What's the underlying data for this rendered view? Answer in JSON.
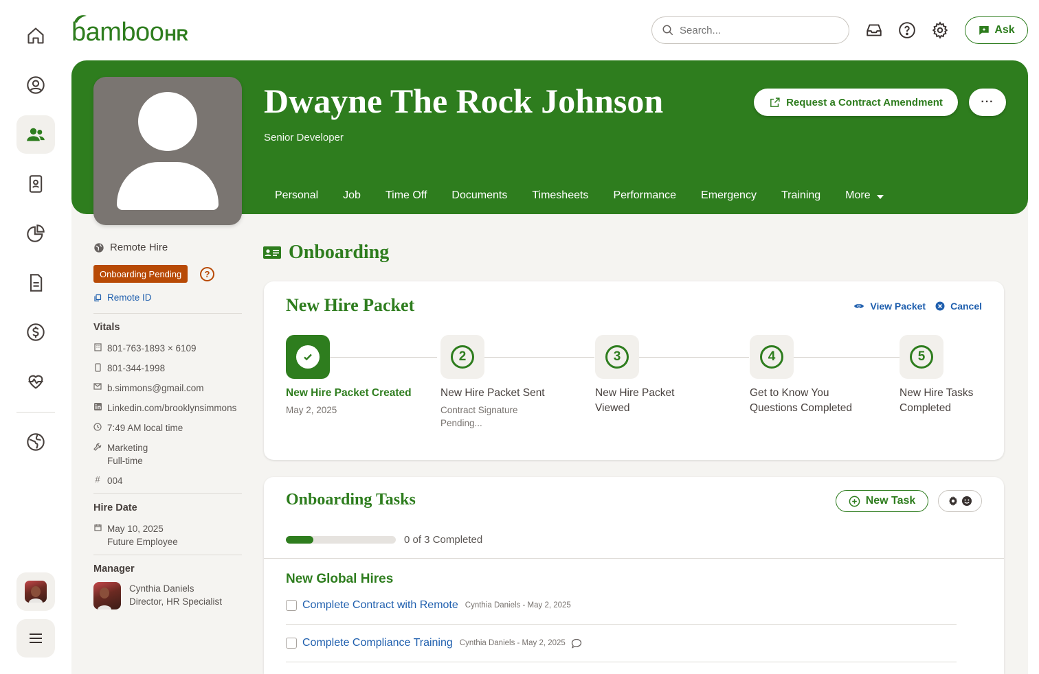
{
  "app": {
    "logo_word": "bamboo",
    "logo_suffix": "HR"
  },
  "search": {
    "placeholder": "Search..."
  },
  "topbar": {
    "ask_label": "Ask",
    "icons": [
      "inbox-icon",
      "help-icon",
      "settings-icon"
    ]
  },
  "rail": {
    "items": [
      "home-icon",
      "user-circle-icon",
      "people-icon",
      "badge-icon",
      "pie-chart-icon",
      "document-icon",
      "dollar-icon",
      "heart-pulse-icon",
      "globe-icon"
    ],
    "active": "people-icon"
  },
  "employee": {
    "name": "Dwayne The Rock Johnson",
    "title": "Senior Developer",
    "amend_label": "Request a Contract Amendment",
    "more_label": "···"
  },
  "tabs": [
    "Personal",
    "Job",
    "Time Off",
    "Documents",
    "Timesheets",
    "Performance",
    "Emergency",
    "Training",
    "More"
  ],
  "side": {
    "remote_hire": "Remote Hire",
    "badge": "Onboarding Pending",
    "remote_id": "Remote ID",
    "vitals_heading": "Vitals",
    "work_phone": "801-763-1893 × 6109",
    "mobile_phone": "801-344-1998",
    "email": "b.simmons@gmail.com",
    "linkedin": "Linkedin.com/brooklynsimmons",
    "local_time": "7:49 AM local time",
    "department": "Marketing",
    "employment_type": "Full-time",
    "employee_number": "004",
    "hire_heading": "Hire Date",
    "hire_date": "May 10, 2025",
    "hire_status": "Future Employee",
    "manager_heading": "Manager",
    "manager_name": "Cynthia Daniels",
    "manager_title": "Director, HR Specialist"
  },
  "onboarding": {
    "title": "Onboarding",
    "packet": {
      "title": "New Hire Packet",
      "view_label": "View Packet",
      "cancel_label": "Cancel",
      "steps": [
        {
          "label": "New Hire Packet Created",
          "sub": "May 2, 2025",
          "done": true
        },
        {
          "label": "New Hire Packet Sent",
          "sub": "Contract Signature Pending...",
          "number": "2"
        },
        {
          "label": "New Hire Packet Viewed",
          "sub": "",
          "number": "3"
        },
        {
          "label": "Get to Know You Questions Completed",
          "sub": "",
          "number": "4"
        },
        {
          "label": "New Hire Tasks Completed",
          "sub": "",
          "number": "5"
        }
      ]
    },
    "tasks": {
      "title": "Onboarding Tasks",
      "new_task_label": "New Task",
      "progress": 0.25,
      "progress_text": "0 of 3 Completed",
      "group_title": "New Global Hires",
      "items": [
        {
          "name": "Complete Contract with Remote",
          "meta": "Cynthia Daniels - May 2, 2025"
        },
        {
          "name": "Complete Compliance Training",
          "meta": "Cynthia Daniels - May 2, 2025"
        }
      ]
    }
  },
  "colors": {
    "brand": "#2e7d1e",
    "badge": "#b84a06",
    "link": "#1f5fae"
  }
}
